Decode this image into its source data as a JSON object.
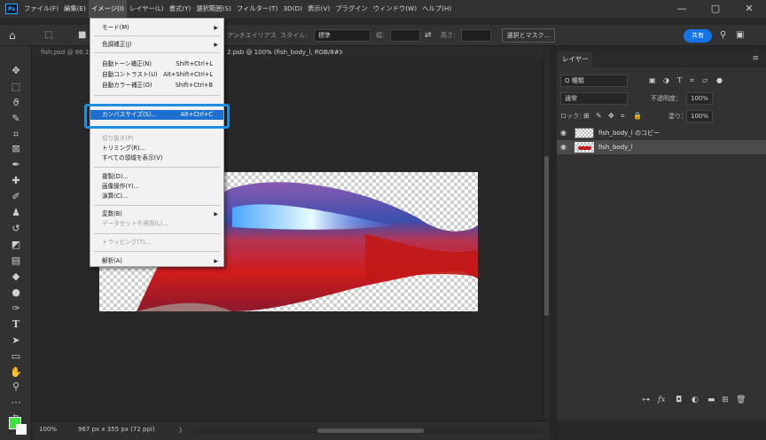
{
  "menubar": {
    "logo": "Ps",
    "items": [
      "ファイル(F)",
      "編集(E)",
      "イメージ(I)",
      "レイヤー(L)",
      "書式(Y)",
      "選択範囲(S)",
      "フィルター(T)",
      "3D(D)",
      "表示(V)",
      "プラグイン",
      "ウィンドウ(W)",
      "ヘルプ(H)"
    ],
    "active_index": 2,
    "window_controls": [
      "—",
      "▢",
      "✕"
    ]
  },
  "options": {
    "antialias": "アンチエイリアス",
    "style_label": "スタイル：",
    "style_value": "標準",
    "width_label": "幅：",
    "height_label": "高さ：",
    "select_mask": "選択とマスク...",
    "share": "共有"
  },
  "tabs": {
    "tab1": "fish.psd @ 86.1%",
    "tab2": "2.psb @ 100% (fish_body_l, RGB/8#)",
    "close": "×"
  },
  "image_menu": {
    "items": [
      {
        "label": "モード(M)",
        "shortcut": "",
        "submenu": true,
        "disabled": false
      },
      {
        "label": "色調補正(J)",
        "shortcut": "",
        "submenu": true,
        "disabled": false
      },
      {
        "label": "自動トーン補正(N)",
        "shortcut": "Shift+Ctrl+L",
        "submenu": false,
        "disabled": false
      },
      {
        "label": "自動コントラスト(U)",
        "shortcut": "Alt+Shift+Ctrl+L",
        "submenu": false,
        "disabled": false
      },
      {
        "label": "自動カラー補正(O)",
        "shortcut": "Shift+Ctrl+B",
        "submenu": false,
        "disabled": false
      },
      {
        "label": "カンバスサイズ(S)...",
        "shortcut": "Alt+Ctrl+C",
        "submenu": false,
        "disabled": false,
        "highlighted": true
      },
      {
        "label": "切り抜き(P)",
        "shortcut": "",
        "submenu": false,
        "disabled": true
      },
      {
        "label": "トリミング(R)...",
        "shortcut": "",
        "submenu": false,
        "disabled": false
      },
      {
        "label": "すべての領域を表示(V)",
        "shortcut": "",
        "submenu": false,
        "disabled": false
      },
      {
        "label": "複製(D)...",
        "shortcut": "",
        "submenu": false,
        "disabled": false
      },
      {
        "label": "画像操作(Y)...",
        "shortcut": "",
        "submenu": false,
        "disabled": false
      },
      {
        "label": "演算(C)...",
        "shortcut": "",
        "submenu": false,
        "disabled": false
      },
      {
        "label": "変数(B)",
        "shortcut": "",
        "submenu": true,
        "disabled": false
      },
      {
        "label": "データセットを適用(L)...",
        "shortcut": "",
        "submenu": false,
        "disabled": true
      },
      {
        "label": "トラッピング(T)...",
        "shortcut": "",
        "submenu": false,
        "disabled": true
      },
      {
        "label": "解析(A)",
        "shortcut": "",
        "submenu": true,
        "disabled": false
      }
    ]
  },
  "status": {
    "zoom": "100%",
    "doc_size": "967 px x 355 px (72 ppi)",
    "arrow": "〉"
  },
  "layers_panel": {
    "title": "レイヤー",
    "filter_kind": "Q 種類",
    "blend_mode": "通常",
    "opacity_label": "不透明度：",
    "opacity_value": "100%",
    "lock_label": "ロック：",
    "fill_label": "塗り：",
    "fill_value": "100%",
    "layers": [
      {
        "name": "fish_body_l のコピー",
        "selected": false
      },
      {
        "name": "fish_body_l",
        "selected": true
      }
    ]
  },
  "colors": {
    "foreground": "#3fe13c",
    "background": "#ffffff",
    "highlight": "#1e6fd0",
    "callout": "#1d8fe0"
  }
}
